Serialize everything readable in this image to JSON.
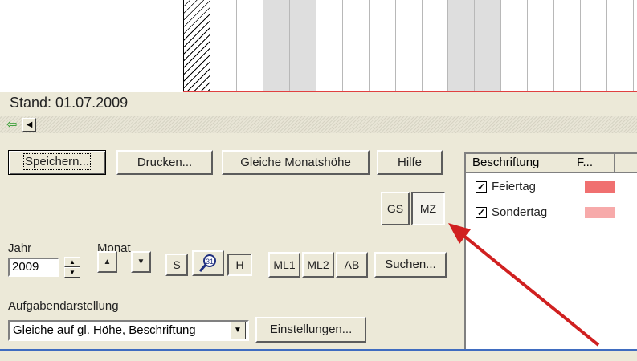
{
  "status": "Stand: 01.07.2009",
  "toolbar": {
    "save_label": "Speichern...",
    "print_label": "Drucken...",
    "same_month_height_label": "Gleiche Monatshöhe",
    "help_label": "Hilfe",
    "gs_label": "GS",
    "mz_label": "MZ"
  },
  "year": {
    "label": "Jahr",
    "value": "2009"
  },
  "month": {
    "label": "Monat"
  },
  "view": {
    "s_label": "S",
    "h_label": "H",
    "ml1_label": "ML1",
    "ml2_label": "ML2",
    "ab_label": "AB",
    "search_label": "Suchen..."
  },
  "task_display": {
    "label": "Aufgabendarstellung",
    "selected": "Gleiche auf gl. Höhe, Beschriftung",
    "settings_label": "Einstellungen..."
  },
  "legend": {
    "columns": [
      "Beschriftung",
      "F..."
    ],
    "rows": [
      {
        "label": "Feiertag",
        "checked": true,
        "color": "#f07070"
      },
      {
        "label": "Sondertag",
        "checked": true,
        "color": "#f7aaaa"
      }
    ]
  },
  "colors": {
    "accent": "#3f6cc0",
    "arrow": "#d02020",
    "calendar_line": "#e04040"
  },
  "icons": [
    "back-arrow-icon",
    "scroll-left-icon",
    "spin-up-icon",
    "spin-down-icon",
    "arrow-up-icon",
    "arrow-down-icon",
    "zoom-icon",
    "dropdown-icon"
  ]
}
